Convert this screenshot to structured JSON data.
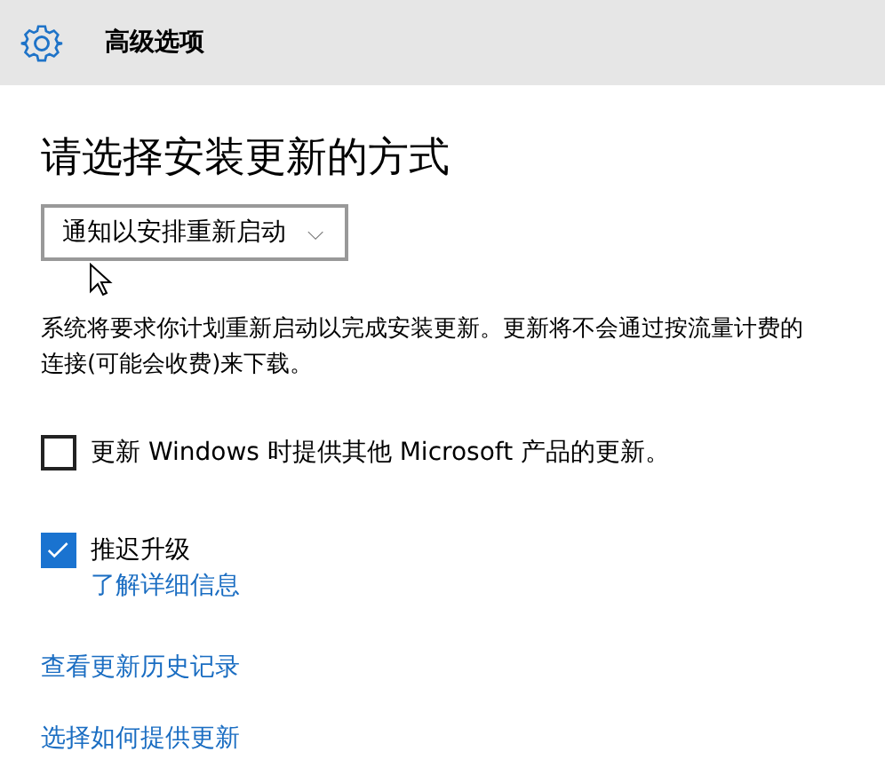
{
  "header": {
    "title": "高级选项"
  },
  "heading": "请选择安装更新的方式",
  "dropdown": {
    "value": "通知以安排重新启动",
    "caret": "⌵"
  },
  "description": "系统将要求你计划重新启动以完成安装更新。更新将不会通过按流量计费的连接(可能会收费)来下载。",
  "options": [
    {
      "label": "更新 Windows 时提供其他 Microsoft 产品的更新。",
      "checked": false
    },
    {
      "label": "推迟升级",
      "checked": true,
      "link": "了解详细信息"
    }
  ],
  "links": [
    "查看更新历史记录",
    "选择如何提供更新"
  ]
}
